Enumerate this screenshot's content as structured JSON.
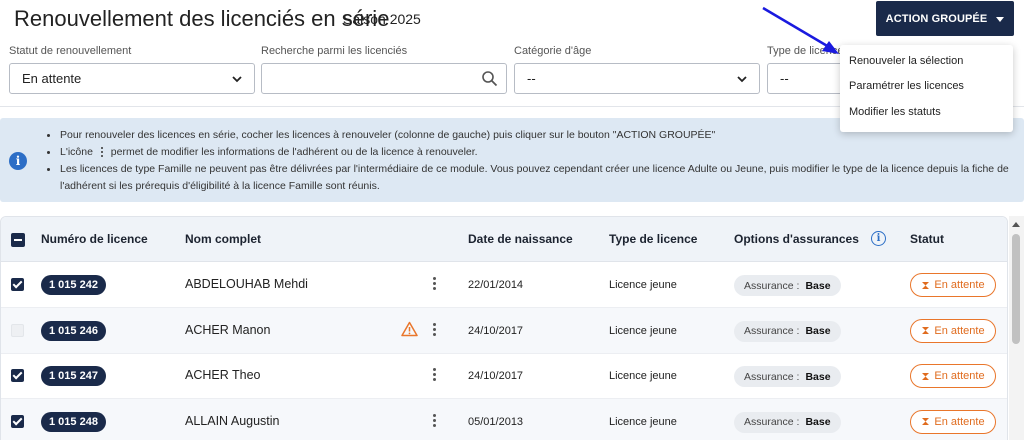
{
  "header": {
    "title": "Renouvellement des licenciés en série",
    "season": "Saison 2025",
    "action_button": "ACTION GROUPÉE"
  },
  "filters": {
    "statut": {
      "label": "Statut de renouvellement",
      "value": "En attente"
    },
    "search": {
      "label": "Recherche parmi les licenciés",
      "placeholder": ""
    },
    "categorie": {
      "label": "Catégorie d'âge",
      "value": "--"
    },
    "type": {
      "label": "Type de licence",
      "value": "--"
    }
  },
  "dropdown": {
    "items": [
      "Renouveler la sélection",
      "Paramétrer les licences",
      "Modifier les statuts"
    ]
  },
  "info": {
    "line1": "Pour renouveler des licences en série, cocher les licences à renouveler (colonne de gauche) puis cliquer sur le bouton \"ACTION GROUPÉE\"",
    "line2_before": "L'icône",
    "line2_after": "permet de modifier les informations de l'adhérent ou de la licence à renouveler.",
    "line3": "Les licences de type Famille ne peuvent pas être délivrées par l'intermédiaire de ce module. Vous pouvez cependant créer une licence Adulte ou Jeune, puis modifier le type de la licence depuis la fiche de l'adhérent si les prérequis d'éligibilité à la licence Famille sont réunis."
  },
  "table": {
    "headers": {
      "numero": "Numéro de licence",
      "nom": "Nom complet",
      "naissance": "Date de naissance",
      "type": "Type de licence",
      "options": "Options d'assurances",
      "statut": "Statut"
    },
    "assurance_label": "Assurance :",
    "rows": [
      {
        "checked": true,
        "disabled": false,
        "numero": "1 015 242",
        "nom": "ABDELOUHAB Mehdi",
        "warning": false,
        "naissance": "22/01/2014",
        "type": "Licence jeune",
        "assurance": "Base",
        "statut": "En attente"
      },
      {
        "checked": false,
        "disabled": true,
        "numero": "1 015 246",
        "nom": "ACHER Manon",
        "warning": true,
        "naissance": "24/10/2017",
        "type": "Licence jeune",
        "assurance": "Base",
        "statut": "En attente"
      },
      {
        "checked": true,
        "disabled": false,
        "numero": "1 015 247",
        "nom": "ACHER Theo",
        "warning": false,
        "naissance": "24/10/2017",
        "type": "Licence jeune",
        "assurance": "Base",
        "statut": "En attente"
      },
      {
        "checked": true,
        "disabled": false,
        "numero": "1 015 248",
        "nom": "ALLAIN Augustin",
        "warning": false,
        "naissance": "05/01/2013",
        "type": "Licence jeune",
        "assurance": "Base",
        "statut": "En attente"
      }
    ]
  },
  "colors": {
    "primary_navy": "#1a2a4a",
    "info_bg": "#dde8f3",
    "status_orange": "#e9762b",
    "annotation_arrow": "#1a1adf"
  }
}
